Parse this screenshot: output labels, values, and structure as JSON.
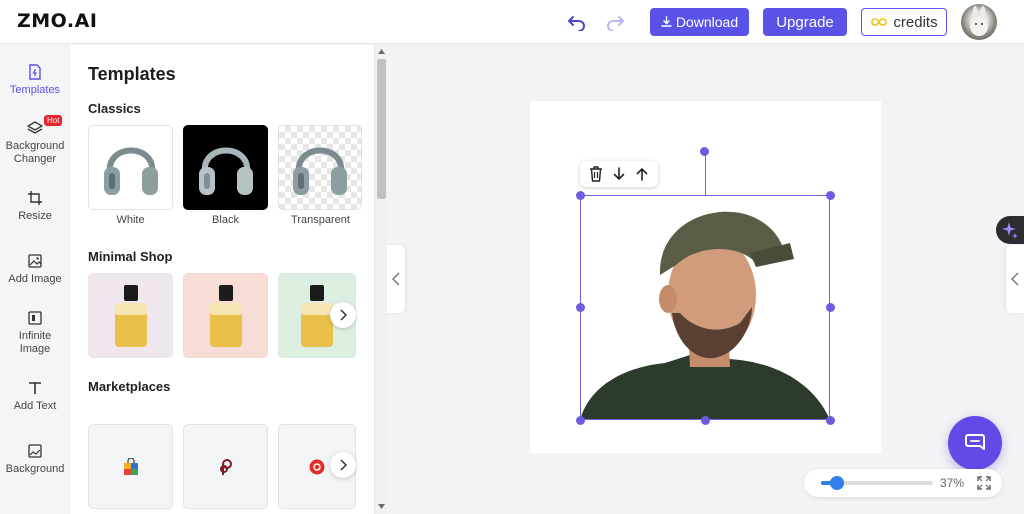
{
  "header": {
    "logo": "ZMO.AI",
    "download_label": "Download",
    "upgrade_label": "Upgrade",
    "credits_label": "credits",
    "icons": [
      "undo-icon",
      "redo-icon",
      "download-icon",
      "infinity-icon"
    ]
  },
  "nav": {
    "items": [
      {
        "label": "Templates",
        "icon": "templates-icon"
      },
      {
        "label": "Background Changer",
        "icon": "layers-icon"
      },
      {
        "label": "Resize",
        "icon": "crop-icon"
      },
      {
        "label": "Add Image",
        "icon": "image-icon"
      },
      {
        "label": "Infinite Image",
        "icon": "expand-image-icon"
      },
      {
        "label": "Add Text",
        "icon": "text-icon"
      },
      {
        "label": "Background",
        "icon": "background-icon"
      }
    ],
    "hot_badge": "Hot"
  },
  "panel": {
    "title": "Templates",
    "sections": [
      {
        "title": "Classics",
        "cards": [
          {
            "label": "White"
          },
          {
            "label": "Black"
          },
          {
            "label": "Transparent"
          }
        ]
      },
      {
        "title": "Minimal Shop"
      },
      {
        "title": "Marketplaces"
      }
    ]
  },
  "zoom": {
    "value": 37,
    "label": "37%"
  },
  "colors": {
    "accent": "#5b53e8",
    "chat": "#6549e6",
    "slider": "#2f80ed",
    "hot": "#e3262b"
  }
}
